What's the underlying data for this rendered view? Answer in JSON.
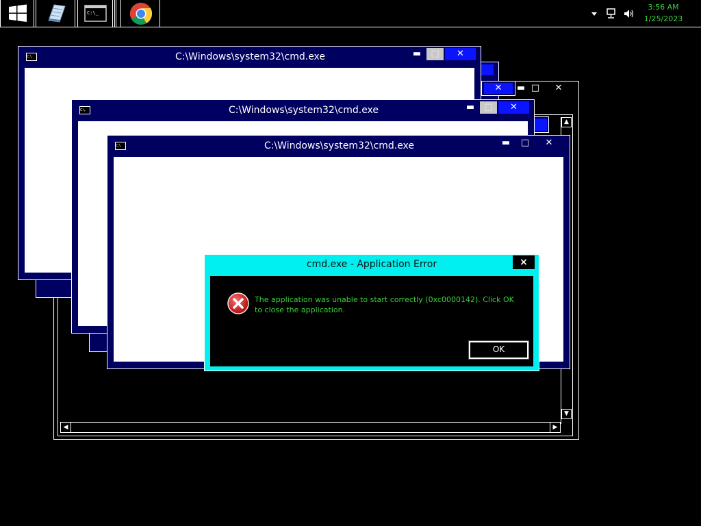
{
  "taskbar": {
    "time": "3:56 AM",
    "date": "1/25/2023",
    "apps": [
      "start-icon",
      "notepad-icon",
      "cmd-icon",
      "chrome-icon"
    ],
    "tray_icons": [
      "chevron-up-icon",
      "network-icon",
      "volume-icon"
    ]
  },
  "windows": {
    "cmd_title": "C:\\Windows\\system32\\cmd.exe",
    "cmd_icon_text": "C:\\."
  },
  "dialog": {
    "title": "cmd.exe - Application Error",
    "message": "The application was unable to start correctly (0xc0000142). Click OK to close the application.",
    "ok_label": "OK",
    "close_label": "×"
  },
  "colors": {
    "window_frame": "#000060",
    "dialog_frame": "#00f0f0",
    "error_text": "#3bd13b",
    "active_button": "#0a14ff"
  }
}
